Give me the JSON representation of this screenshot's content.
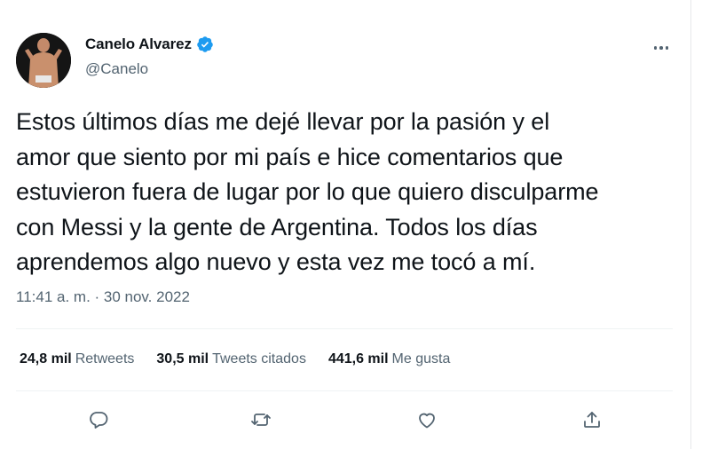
{
  "author": {
    "display_name": "Canelo Alvarez",
    "handle": "@Canelo",
    "verified": true,
    "verified_color": "#1d9bf0"
  },
  "tweet": {
    "text": "Estos últimos días me dejé llevar por la pasión y el\namor que siento por mi país e hice comentarios que\nestuvieron fuera de lugar por lo que quiero disculparme\ncon Messi y la gente de Argentina. Todos los días\naprendemos algo nuevo y esta vez me tocó a mí.",
    "timestamp": "11:41 a. m. · 30 nov. 2022"
  },
  "stats": [
    {
      "count": "24,8 mil",
      "label": "Retweets"
    },
    {
      "count": "30,5 mil",
      "label": "Tweets citados"
    },
    {
      "count": "441,6 mil",
      "label": "Me gusta"
    }
  ],
  "actions": [
    "reply-icon",
    "retweet-icon",
    "like-icon",
    "share-icon"
  ],
  "colors": {
    "text": "#0f1419",
    "secondary": "#536471",
    "divider": "#eff3f4"
  }
}
